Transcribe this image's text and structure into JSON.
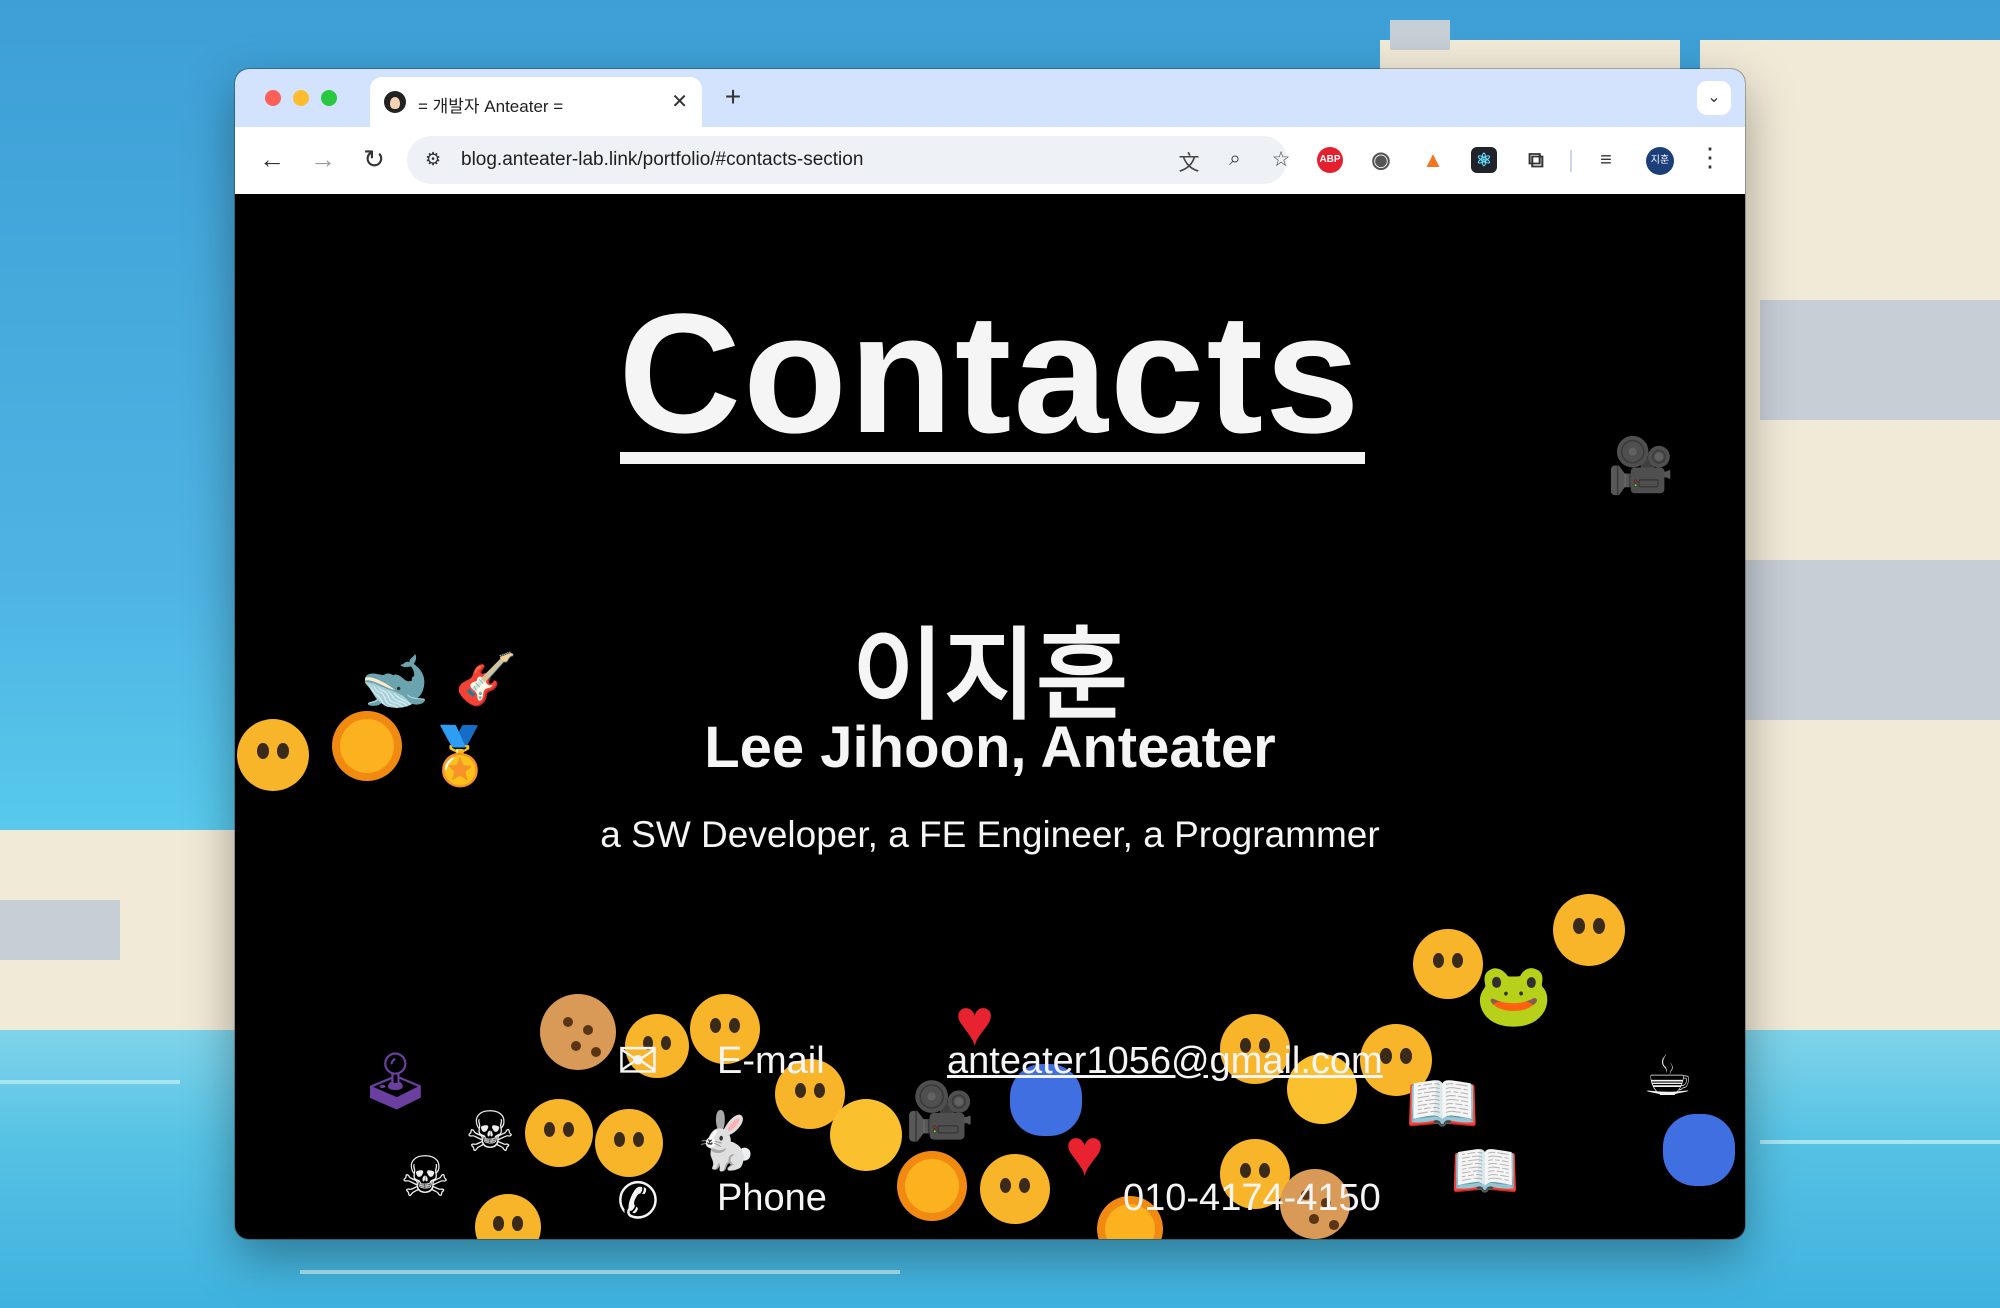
{
  "browser": {
    "tab_title": "= 개발자 Anteater =",
    "tab_close": "✕",
    "new_tab": "+",
    "tab_search_icon": "⌄",
    "url": "blog.anteater-lab.link/portfolio/#contacts-section",
    "extensions": {
      "abp": "ABP",
      "avatar": "지훈"
    }
  },
  "page": {
    "heading": "Contacts",
    "name_korean": "이지훈",
    "name_english": "Lee Jihoon, Anteater",
    "tagline": "a SW Developer, a FE Engineer, a Programmer",
    "contacts": [
      {
        "icon": "envelope-icon",
        "label": "E-mail",
        "value": "anteater1056@gmail.com"
      },
      {
        "icon": "phone-icon",
        "label": "Phone",
        "value": "010-4174-4150"
      }
    ]
  }
}
